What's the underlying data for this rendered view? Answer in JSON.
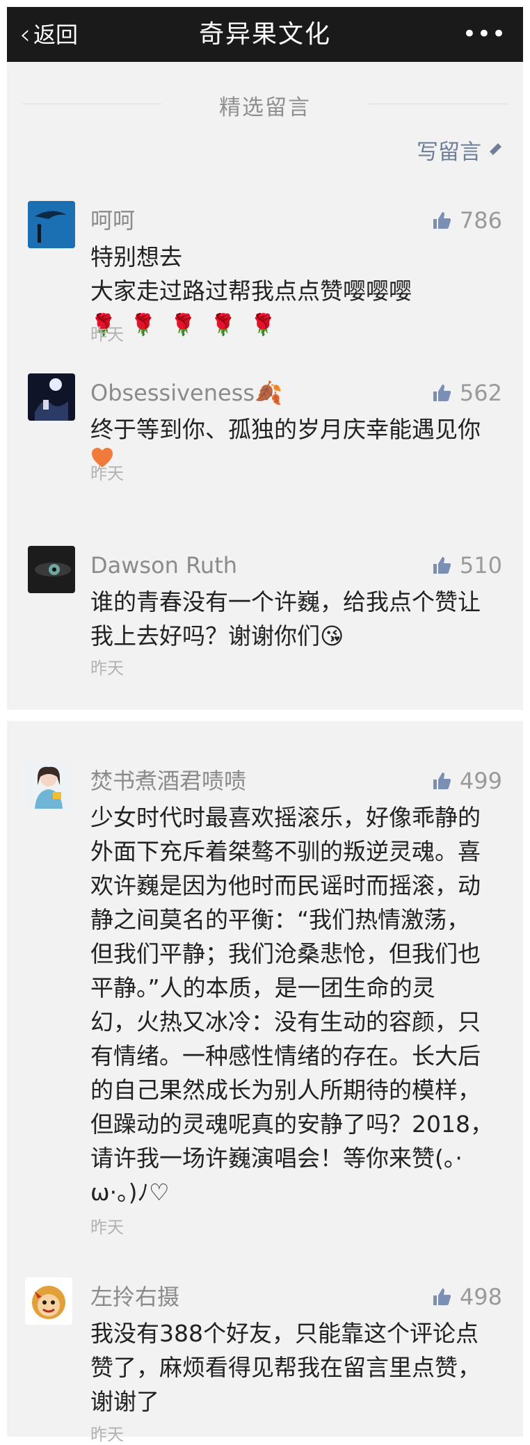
{
  "nav": {
    "back_label": "返回",
    "title": "奇异果文化",
    "more_icon": "more-icon"
  },
  "section": {
    "title": "精选留言",
    "write_label": "写留言"
  },
  "comments": [
    {
      "name": "呵呵",
      "likes": "786",
      "lines": [
        "特别想去",
        "大家走过路过帮我点点赞嘤嘤嘤"
      ],
      "emoji": "🌹🌹🌹🌹🌹",
      "time": "昨天"
    },
    {
      "name": "Obsessiveness🍂",
      "likes": "562",
      "lines": [
        "终于等到你、孤独的岁月庆幸能遇见你"
      ],
      "emoji": "🧡",
      "time": "昨天"
    },
    {
      "name": "Dawson Ruth",
      "likes": "510",
      "lines": [
        "谁的青春没有一个许巍，给我点个赞让",
        "我上去好吗？谢谢你们😘"
      ],
      "time": "昨天"
    },
    {
      "name": "焚书煮酒君啧啧",
      "likes": "499",
      "lines": [
        "少女时代时最喜欢摇滚乐，好像乖静的",
        "外面下充斥着桀骜不驯的叛逆灵魂。喜",
        "欢许巍是因为他时而民谣时而摇滚，动",
        "静之间莫名的平衡：“我们热情激荡，",
        "但我们平静；我们沧桑悲怆，但我们也",
        "平静。”人的本质，是一团生命的灵",
        "幻，火热又冰冷：没有生动的容颜，只",
        "有情绪。一种感性情绪的存在。长大后",
        "的自己果然成长为别人所期待的模样，",
        "但躁动的灵魂呢真的安静了吗？2018，",
        "请许我一场许巍演唱会！等你来赞(。·",
        "ω·。)ﾉ♡"
      ],
      "time": "昨天"
    },
    {
      "name": "左拎右摄",
      "likes": "498",
      "lines": [
        "我没有388个好友，只能靠这个评论点",
        "赞了，麻烦看得见帮我在留言里点赞，",
        "谢谢了"
      ],
      "time": "昨天"
    }
  ]
}
